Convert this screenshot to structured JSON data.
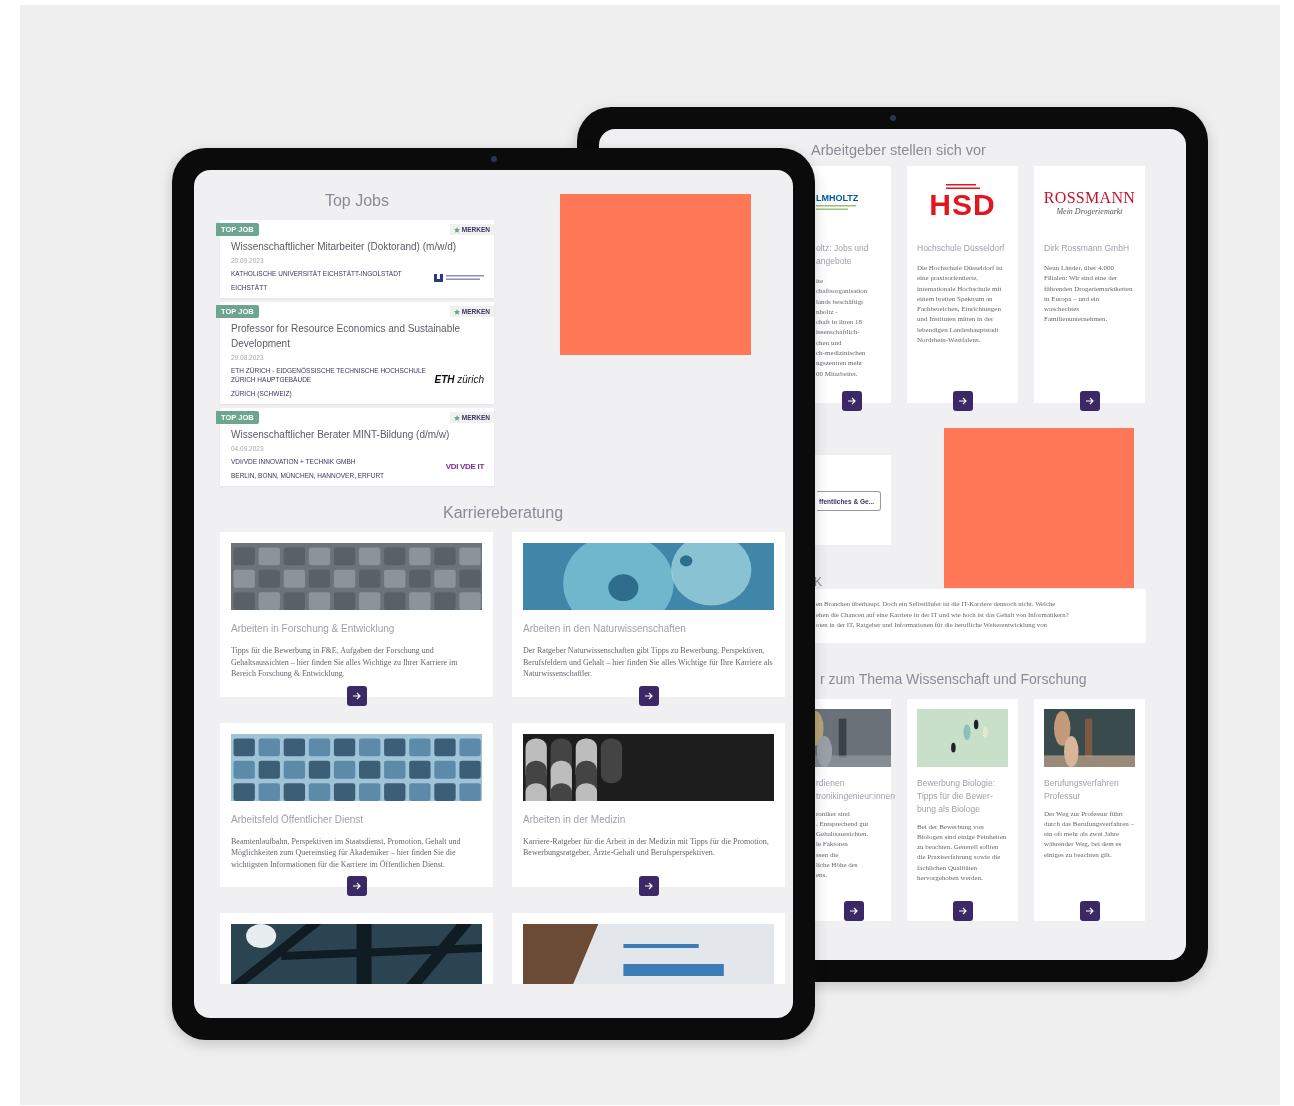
{
  "front": {
    "overlay": {
      "kind": "block"
    },
    "top_jobs": {
      "title": "Top Jobs",
      "jobs": [
        {
          "badge": "TOP JOB",
          "save": "MERKEN",
          "title": "Wissenschaftlicher Mitarbeiter (Doktorand) (m/w/d)",
          "date": "20.09.2023",
          "employer": "KATHOLISCHE UNIVERSITÄT EICHSTÄTT-INGOLSTADT",
          "location": "EICHSTÄTT",
          "logo": {
            "kind": "emblem"
          }
        },
        {
          "badge": "TOP JOB",
          "save": "MERKEN",
          "title": "Professor for Resource Economics and Sustainable Development",
          "date": "29.08.2023",
          "employer": "ETH ZÜRICH - EIDGENÖSSISCHE TECHNISCHE HOCHSCHULE ZÜRICH HAUPTGEBÄUDE",
          "location": "ZÜRICH (SCHWEIZ)",
          "logo": {
            "kind": "wordmark",
            "bold": "ETH",
            "light": "zürich"
          }
        },
        {
          "badge": "TOP JOB",
          "save": "MERKEN",
          "title": "Wissenschaftlicher Berater MINT-Bildung (d/m/w)",
          "date": "04.09.2023",
          "employer": "VDI/VDE INNOVATION + TECHNIK GMBH",
          "location": "BERLIN, BONN, MÜNCHEN, HANNOVER, ERFURT",
          "logo": {
            "kind": "letters",
            "text": "VDI VDE IT"
          }
        }
      ]
    },
    "career": {
      "title": "Karriereberatung",
      "articles": [
        {
          "image": {
            "kind": "picture"
          },
          "title": "Arbeiten in Forschung & Entwicklung",
          "text": "Tipps für die Bewerbung in F&E, Aufgaben der Forschung und Gehaltsaussichten – hier finden Sie alles Wichtige zu Ihrer Karriere im Bereich Forschung & Entwicklung."
        },
        {
          "image": {
            "kind": "picture"
          },
          "title": "Arbeiten in den Naturwissenschaften",
          "text": "Der Ratgeber Naturwissenschaften gibt Tipps zu Bewerbung, Perspektiven, Berufsfeldern und Gehalt – hier finden Sie alles Wichtige für Ihre Karriere als Naturwissenschaftler."
        },
        {
          "image": {
            "kind": "picture"
          },
          "title": "Arbeitsfeld Öffentlicher Dienst",
          "text": "Beamtenlaufbahn, Perspektiven im Staatsdienst, Promotion, Gehalt und Möglichkeiten zum Quereinstieg für Akademiker – hier finden Sie die wichtigsten Informationen für die Karriere im Öffentlichen Dienst."
        },
        {
          "image": {
            "kind": "picture"
          },
          "title": "Arbeiten in der Medizin",
          "text": "Karriere-Ratgeber für die Arbeit in der Medizin mit Tipps für die Promotion, Bewerbungsratgeber, Ärzte-Gehalt und Berufsperspektiven."
        },
        {
          "image": {
            "kind": "picture"
          }
        },
        {
          "image": {
            "kind": "picture"
          }
        }
      ]
    }
  },
  "back": {
    "overlay": {
      "kind": "block"
    },
    "employers": {
      "title": "Arbeitgeber stellen sich vor",
      "items": [
        {
          "logo": {
            "kind": "helmholtz",
            "text": "LMHOLTZ"
          },
          "title": "oltz: Jobs und\nangebote",
          "text": "ite\nchaftsorganisation\nlands beschäftigt\nnholtz -\nchaft in ihren 18\nissenschaftlich-\nchen und\nch-medizinischen\nngszentren mehr\n00 Mitarbeiter."
        },
        {
          "logo": {
            "kind": "hsd",
            "text": "HSD"
          },
          "title": "Hochschule Düsseldorf",
          "text": "Die Hochschule Düsseldorf ist eine praxisorientierte, internationale Hochschule mit einem breiten Spektrum an Fachbereichen, Einrichtungen und Instituten mitten in der lebendigen Landeshauptstadt Nordrhein-Westfalens."
        },
        {
          "logo": {
            "kind": "rossmann",
            "text": "ROSSMANN",
            "tagline": "Mein Drogeriemarkt"
          },
          "title": "Dirk Rossmann GmbH",
          "text": "Neun Länder, über 4.000 Filialen: Wir sind eine der führenden Drogeriemarktketten in Europa – und ein waschechtes Familienunternehmen."
        }
      ]
    },
    "filter_button": "ffentliches & Ge...",
    "it_section": {
      "title": "K",
      "text": "en Branchen überhaupt. Doch ein Selbstläufer ist die IT-Karriere dennoch nicht. Welche\nehen die Chancen auf eine Karriere in der IT und wie hoch ist das Gehalt von Informatikern?\noten in der IT, Ratgeber und Informationen für die berufliche Weiterentwicklung von"
    },
    "science": {
      "title": "r zum Thema Wissenschaft und Forschung",
      "items": [
        {
          "image": {
            "kind": "picture"
          },
          "title": "rdienen\ntronikingenieur:innen",
          "text": "roniker sind\n. Entsprechend gut\nGehaltsaussichten.\nle Faktoren\nssen die\nliche Höhe des\nens."
        },
        {
          "image": {
            "kind": "picture"
          },
          "title": "Bewerbung Biologie: Tipps für die Bewer-\nbung als Biologe",
          "text": "Bei der Bewerbung von Biologen sind einige Feinheiten zu beachten. Generell sollten die Praxiserfahrung sowie die fachlichen Qualitäten hervorgehoben werden."
        },
        {
          "image": {
            "kind": "picture"
          },
          "title": "Berufungsverfahren Professur",
          "text": "Der Weg zur Professur führt durch das Berufungsverfahren – ein oft mehr als zwei Jahre währender Weg, bei dem es einiges zu beachten gilt."
        }
      ]
    }
  }
}
